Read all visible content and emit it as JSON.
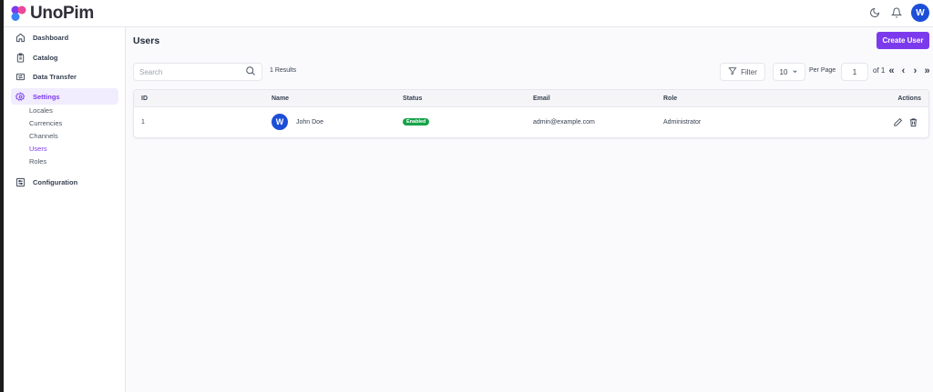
{
  "app": {
    "logo_text": "UnoPim"
  },
  "header": {
    "icons": [
      "moon-icon",
      "bell-icon",
      "user-avatar"
    ],
    "avatar_letter": "W"
  },
  "sidebar": {
    "items": [
      {
        "label": "Dashboard",
        "icon": "home-icon",
        "active": false
      },
      {
        "label": "Catalog",
        "icon": "clipboard-icon",
        "active": false
      },
      {
        "label": "Data Transfer",
        "icon": "transfer-icon",
        "active": false
      },
      {
        "label": "Settings",
        "icon": "gear-icon",
        "active": true
      },
      {
        "label": "Configuration",
        "icon": "sliders-icon",
        "active": false
      }
    ],
    "settings_sub": [
      {
        "label": "Locales",
        "active": false
      },
      {
        "label": "Currencies",
        "active": false
      },
      {
        "label": "Channels",
        "active": false
      },
      {
        "label": "Users",
        "active": true
      },
      {
        "label": "Roles",
        "active": false
      }
    ]
  },
  "main": {
    "title": "Users",
    "create_button": "Create User",
    "search": {
      "placeholder": "Search"
    },
    "results_text": "1 Results",
    "filter_label": "Filter",
    "per_page_value": "10",
    "per_page_label": "Per Page",
    "page_value": "1",
    "page_of": "of 1",
    "pager_icons": [
      "double-left-icon",
      "left-icon",
      "right-icon",
      "double-right-icon"
    ],
    "table": {
      "columns": [
        "ID",
        "Name",
        "Status",
        "Email",
        "Role",
        "Actions"
      ],
      "rows": [
        {
          "id": "1",
          "name": "John Doe",
          "avatar_letter": "W",
          "status": "Enabled",
          "email": "admin@example.com",
          "role": "Administrator"
        }
      ]
    }
  },
  "colors": {
    "accent": "#7c3aed",
    "active_bg": "#f1ecfe",
    "status_enabled": "#16a34a",
    "avatar": "#1d4ed8"
  }
}
